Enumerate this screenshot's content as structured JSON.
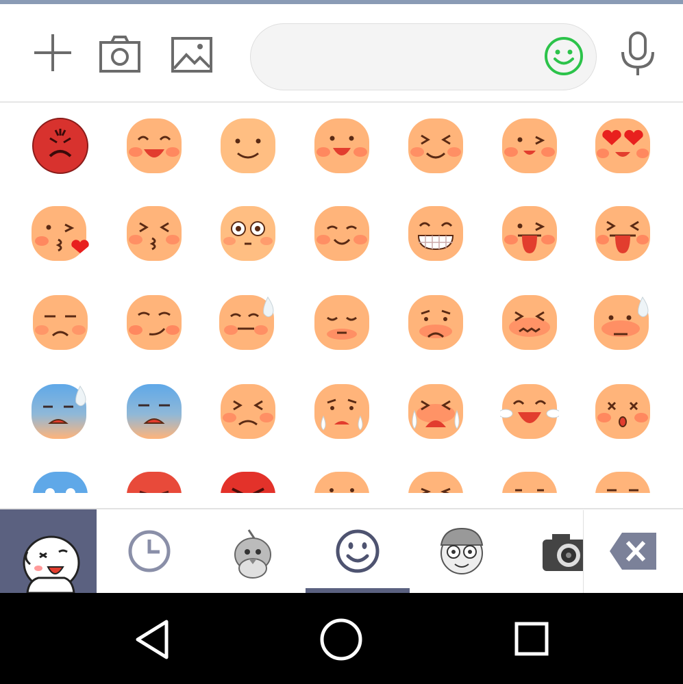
{
  "colors": {
    "accent": "#2cc34a",
    "tab_active": "#5b6180",
    "top_line": "#8a9bb5",
    "nav_bg": "#000000",
    "emoji_face": "#ffb47a",
    "emoji_cheek": "#ff6a4d",
    "angry_face": "#d8322e",
    "scared_face": "#5fa8e8"
  },
  "toolbar": {
    "icons": [
      "plus-icon",
      "camera-icon",
      "image-icon"
    ],
    "message_input": {
      "value": "",
      "placeholder": ""
    },
    "emoji_toggle_icon": "smiley-icon",
    "mic_icon": "microphone-icon"
  },
  "emoji_grid": {
    "rows": [
      [
        "angry",
        "laugh",
        "smile",
        "grin",
        "squint-smile",
        "wink",
        "heart-eyes"
      ],
      [
        "kiss-heart",
        "kiss",
        "surprised",
        "content",
        "big-grin",
        "tongue-wink",
        "tongue-squint"
      ],
      [
        "unamused",
        "smirk",
        "sweat-smile",
        "relieved",
        "sad",
        "confounded",
        "sweat-sad"
      ],
      [
        "fearful-sweat",
        "scared",
        "tired",
        "crying",
        "sobbing",
        "tears-of-joy",
        "dizzy"
      ],
      [
        "blue-partial",
        "red-partial",
        "angry-partial",
        "face-partial",
        "face-partial",
        "face-partial",
        "face-partial"
      ]
    ]
  },
  "tabs": [
    {
      "name": "sticker-pack-moon",
      "icon": "moon-character-icon",
      "active": false
    },
    {
      "name": "recent",
      "icon": "clock-icon",
      "active": false
    },
    {
      "name": "sticker-pack-bird",
      "icon": "bird-icon",
      "active": false
    },
    {
      "name": "emoji",
      "icon": "smiley-tab-icon",
      "active": true
    },
    {
      "name": "sticker-pack-cap",
      "icon": "cap-character-icon",
      "active": false
    },
    {
      "name": "sticker-pack-camera",
      "icon": "camera-sticker-icon",
      "active": false
    }
  ],
  "backspace_icon": "backspace-icon",
  "navbar": {
    "icons": [
      "back-icon",
      "home-icon",
      "recents-icon"
    ]
  }
}
